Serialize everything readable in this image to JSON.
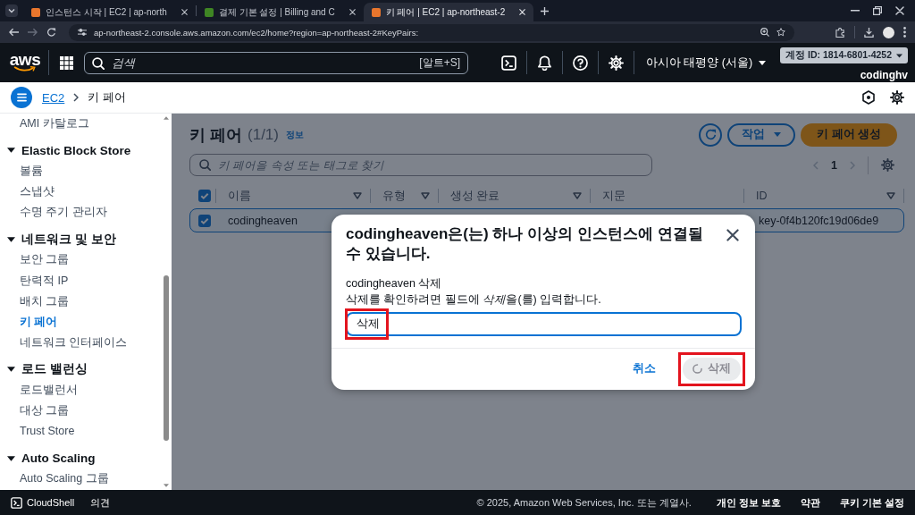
{
  "browser": {
    "tabs": [
      {
        "title": "인스턴스 시작 | EC2 | ap-north",
        "color": "#e8762d",
        "selected": false
      },
      {
        "title": "결제 기본 설정 | Billing and C",
        "color": "#3f8624",
        "selected": false
      },
      {
        "title": "키 페어 | EC2 | ap-northeast-2",
        "color": "#e8762d",
        "selected": true
      }
    ],
    "forward_disabled": true,
    "url": "ap-northeast-2.console.aws.amazon.com/ec2/home?region=ap-northeast-2#KeyPairs:"
  },
  "top_nav": {
    "logo": "aws",
    "search": {
      "placeholder": "검색",
      "shortcut": "[알트+S]"
    },
    "region": "아시아 태평양 (서울)",
    "account": "계정 ID: 1814-6801-4252",
    "user": "codinghv"
  },
  "breadcrumb": [
    {
      "kind": "link",
      "label": "EC2"
    },
    {
      "kind": "current",
      "label": "키 페어"
    }
  ],
  "sidebar": {
    "items": [
      {
        "kind": "link",
        "label": "AMI 카탈로그",
        "selected": false
      },
      {
        "kind": "section",
        "label": "Elastic Block Store",
        "expanded": true,
        "children": [
          {
            "kind": "link",
            "label": "볼륨",
            "selected": false
          },
          {
            "kind": "link",
            "label": "스냅샷",
            "selected": false
          },
          {
            "kind": "link",
            "label": "수명 주기 관리자",
            "selected": false
          }
        ]
      },
      {
        "kind": "section",
        "label": "네트워크 및 보안",
        "expanded": true,
        "children": [
          {
            "kind": "link",
            "label": "보안 그룹",
            "selected": false
          },
          {
            "kind": "link",
            "label": "탄력적 IP",
            "selected": false
          },
          {
            "kind": "link",
            "label": "배치 그룹",
            "selected": false
          },
          {
            "kind": "link",
            "label": "키 페어",
            "selected": true
          },
          {
            "kind": "link",
            "label": "네트워크 인터페이스",
            "selected": false
          }
        ]
      },
      {
        "kind": "section",
        "label": "로드 밸런싱",
        "expanded": true,
        "children": [
          {
            "kind": "link",
            "label": "로드밸런서",
            "selected": false
          },
          {
            "kind": "link",
            "label": "대상 그룹",
            "selected": false
          },
          {
            "kind": "link",
            "label": "Trust Store",
            "selected": false
          }
        ]
      },
      {
        "kind": "section",
        "label": "Auto Scaling",
        "expanded": true,
        "children": [
          {
            "kind": "link",
            "label": "Auto Scaling 그룹",
            "selected": false
          }
        ]
      }
    ]
  },
  "main": {
    "title": "키 페어",
    "count": "(1/1)",
    "info": "정보",
    "actions": "작업",
    "create": "키 페어 생성",
    "search_placeholder": "키 페어을 속성 또는 태그로 찾기",
    "pagination": {
      "page": "1",
      "previous_disabled": true,
      "next_disabled": true
    }
  },
  "table": {
    "all_selected": true,
    "columns": [
      {
        "label": "이름",
        "sortable": true
      },
      {
        "label": "유형",
        "sortable": true
      },
      {
        "label": "생성 완료",
        "sortable": true
      },
      {
        "label": "지문",
        "sortable": false
      },
      {
        "label": "ID",
        "sortable": true
      }
    ],
    "rows": [
      {
        "selected": true,
        "name": "codingheaven",
        "id": "key-0f4b120fc19d06de9"
      }
    ]
  },
  "dialog": {
    "title": "codingheaven은(는) 하나 이상의 인스턴스에 연결될 수 있습니다.",
    "label": "codingheaven 삭제",
    "hint": [
      {
        "text": "삭제를 확인하려면 필드에 ",
        "italic": false
      },
      {
        "text": "삭제",
        "italic": true
      },
      {
        "text": "을(를) 입력합니다.",
        "italic": false
      }
    ],
    "input": {
      "value": "삭제",
      "highlighted": true
    },
    "cancel": "취소",
    "delete": {
      "label": "삭제",
      "loading": true,
      "disabled": true,
      "highlighted": true
    }
  },
  "footer": {
    "cloudshell": "CloudShell",
    "feedback": "의견",
    "copyright": "© 2025, Amazon Web Services, Inc. 또는 계열사.",
    "links": [
      "개인 정보 보호",
      "약관",
      "쿠키 기본 설정"
    ]
  }
}
